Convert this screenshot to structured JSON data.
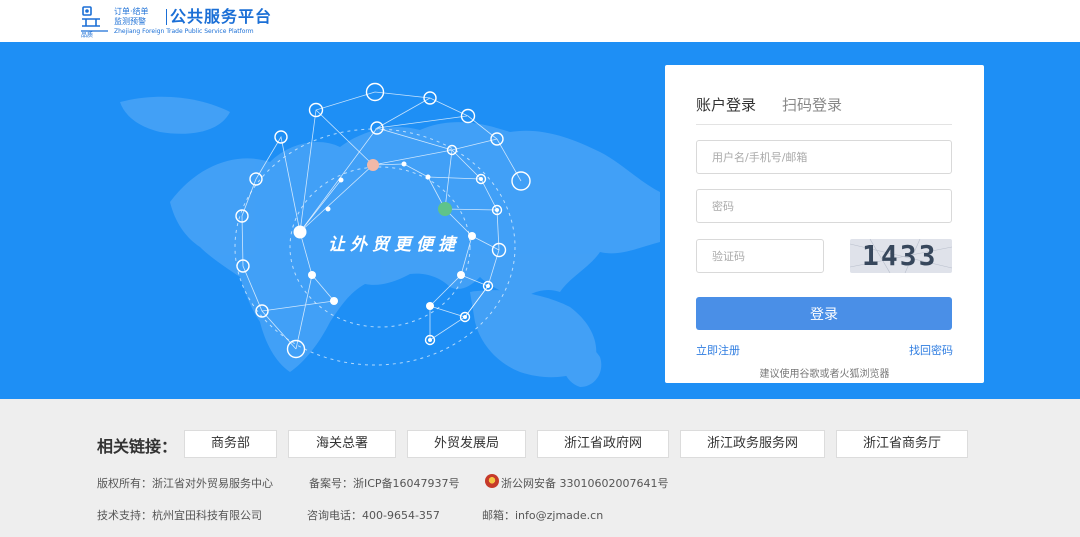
{
  "header": {
    "logo_small_text": "订单·结单\n监测预警",
    "logo_title": "公共服务平台",
    "logo_subtitle": "Zhejiang Foreign Trade Public Service Platform"
  },
  "banner": {
    "slogan": "让外贸更便捷",
    "background_color": "#1e8ff5"
  },
  "login": {
    "tab_account": "账户登录",
    "tab_scan": "扫码登录",
    "username_placeholder": "用户名/手机号/邮箱",
    "password_placeholder": "密码",
    "captcha_placeholder": "验证码",
    "captcha_text": "1433",
    "login_button": "登录",
    "register_link": "立即注册",
    "find_password_link": "找回密码",
    "browser_tip": "建议使用谷歌或者火狐浏览器",
    "accent_color": "#4a8fe7"
  },
  "footer": {
    "links_title": "相关链接：",
    "links": [
      "商务部",
      "海关总署",
      "外贸发展局",
      "浙江省政府网",
      "浙江政务服务网",
      "浙江省商务厅"
    ],
    "copyright": "版权所有：浙江省对外贸易服务中心",
    "icp": "备案号：浙ICP备16047937号",
    "police_record": "浙公网安备 33010602007641号",
    "tech_support": "技术支持：杭州宜田科技有限公司",
    "hotline": "咨询电话：400-9654-357",
    "email": "邮箱：info@zjmade.cn"
  }
}
